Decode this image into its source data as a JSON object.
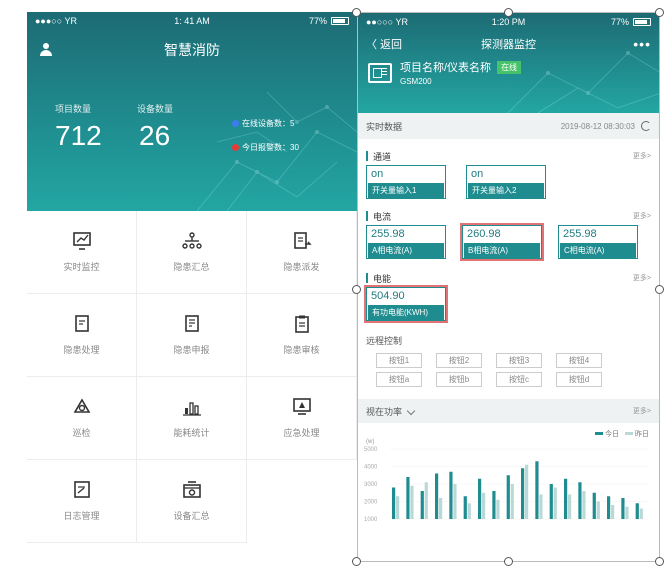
{
  "left": {
    "status": {
      "carrier": "●●●○○ YR",
      "time": "1: 41 AM",
      "battery": "77%"
    },
    "title": "智慧消防",
    "stats": [
      {
        "label": "项目数量",
        "value": "712"
      },
      {
        "label": "设备数量",
        "value": "26"
      }
    ],
    "online": {
      "online_label": "在线设备数：5",
      "alarm_label": "今日报警数：30"
    },
    "grid": [
      {
        "label": "实时监控",
        "icon": "monitor-chart-icon"
      },
      {
        "label": "隐患汇总",
        "icon": "hierarchy-icon"
      },
      {
        "label": "隐患派发",
        "icon": "dispatch-icon"
      },
      {
        "label": "隐患处理",
        "icon": "document-icon"
      },
      {
        "label": "隐患申报",
        "icon": "report-icon"
      },
      {
        "label": "隐患审核",
        "icon": "clipboard-icon"
      },
      {
        "label": "巡检",
        "icon": "patrol-icon"
      },
      {
        "label": "能耗统计",
        "icon": "bar-stats-icon"
      },
      {
        "label": "应急处理",
        "icon": "emergency-icon"
      },
      {
        "label": "日志管理",
        "icon": "log-icon"
      },
      {
        "label": "设备汇总",
        "icon": "device-icon"
      }
    ]
  },
  "right": {
    "status": {
      "carrier": "●●○○○ YR",
      "time": "1:20 PM",
      "battery": "77%"
    },
    "nav": {
      "back": "〈 返回",
      "title": "探测器监控",
      "more": "•••"
    },
    "project": {
      "name": "项目名称/仪表名称",
      "badge": "在线",
      "model": "GSM200"
    },
    "realtime": {
      "label": "实时数据",
      "timestamp": "2019-08-12 08:30:03"
    },
    "channel": {
      "title": "通道",
      "more": "更多>",
      "items": [
        {
          "value": "on",
          "name": "开关量输入1"
        },
        {
          "value": "on",
          "name": "开关量输入2"
        }
      ]
    },
    "current": {
      "title": "电流",
      "more": "更多>",
      "items": [
        {
          "value": "255.98",
          "name": "A相电流(A)"
        },
        {
          "value": "260.98",
          "name": "B相电流(A)"
        },
        {
          "value": "255.98",
          "name": "C相电流(A)"
        }
      ]
    },
    "energy": {
      "title": "电能",
      "more": "更多>",
      "items": [
        {
          "value": "504.90",
          "name": "有功电能(KWH)"
        }
      ]
    },
    "remote": {
      "title": "远程控制",
      "row1": [
        "按钮1",
        "按钮2",
        "按钮3",
        "按钮4"
      ],
      "row2": [
        "按钮a",
        "按钮b",
        "按钮c",
        "按钮d"
      ]
    },
    "power": {
      "label": "视在功率",
      "more": "更多>"
    }
  },
  "chart_data": {
    "type": "bar",
    "ylabel": "(w)",
    "ylim": [
      1000,
      5000
    ],
    "yticks": [
      5000,
      4000,
      3000,
      2000,
      1000
    ],
    "legend_position": "top-right",
    "series": [
      {
        "name": "今日",
        "color": "#1f8c8f",
        "values": [
          2800,
          3400,
          2600,
          3600,
          3700,
          2300,
          3300,
          2600,
          3500,
          3900,
          4300,
          3000,
          3300,
          3100,
          2500,
          2300,
          2200,
          1900
        ]
      },
      {
        "name": "昨日",
        "color": "#b9d8d8",
        "values": [
          2300,
          2900,
          3100,
          2200,
          3000,
          1900,
          2500,
          2100,
          3000,
          4100,
          2400,
          2800,
          2400,
          2600,
          2000,
          1800,
          1700,
          1600
        ]
      }
    ]
  }
}
